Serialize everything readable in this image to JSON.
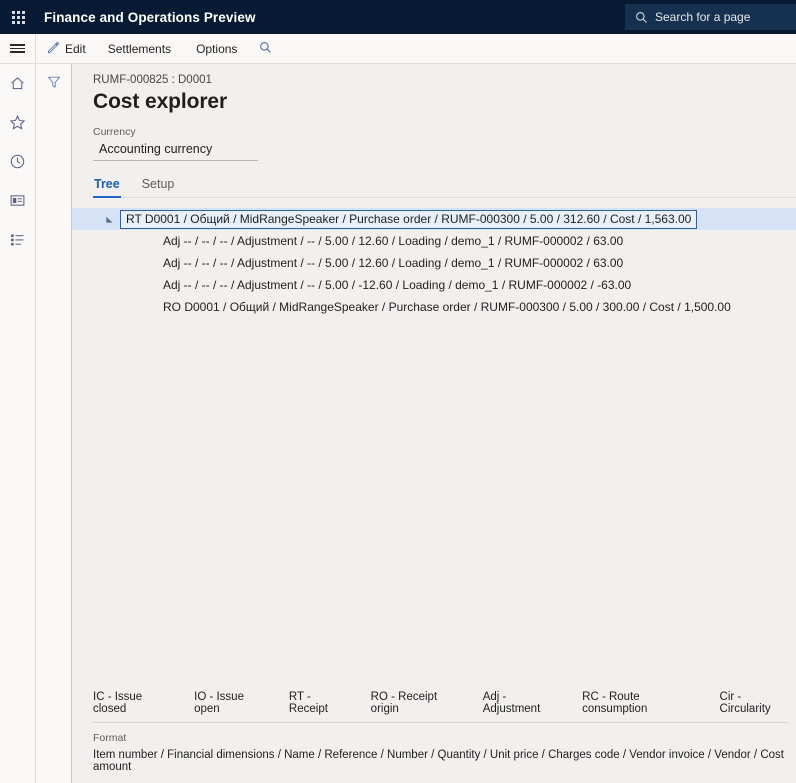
{
  "topbar": {
    "waffle_icon": "app-launcher-grid-icon",
    "app_title": "Finance and Operations Preview",
    "search": {
      "icon": "search-icon",
      "placeholder": "Search for a page",
      "value": "Search for a page"
    }
  },
  "commandbar": {
    "hamburger_icon": "hamburger-menu-icon",
    "buttons": [
      {
        "label": "Edit",
        "icon": "pencil-edit-icon"
      },
      {
        "label": "Settlements",
        "icon": ""
      },
      {
        "label": "Options",
        "icon": ""
      }
    ],
    "search_icon": "search-icon"
  },
  "navrail": {
    "items": [
      {
        "name": "home",
        "icon": "home-icon"
      },
      {
        "name": "favorites",
        "icon": "star-icon"
      },
      {
        "name": "recent",
        "icon": "clock-icon"
      },
      {
        "name": "workspaces",
        "icon": "workspace-icon"
      },
      {
        "name": "modules",
        "icon": "modules-list-icon"
      }
    ]
  },
  "filterpane": {
    "icon": "filter-funnel-icon"
  },
  "page": {
    "breadcrumb": "RUMF-000825 : D0001",
    "title": "Cost explorer",
    "currency": {
      "label": "Currency",
      "value": "Accounting currency"
    },
    "tabs": [
      {
        "label": "Tree",
        "active": true
      },
      {
        "label": "Setup",
        "active": false
      }
    ]
  },
  "tree": {
    "rows": [
      {
        "text": "RT D0001 / Общий / MidRangeSpeaker / Purchase order / RUMF-000300 / 5.00 / 312.60 / Cost / 1,563.00",
        "level": 0,
        "selected": true,
        "expanded": true,
        "toggle_icon": "expanded-triangle-icon"
      },
      {
        "text": "Adj -- / -- / -- / Adjustment / -- / 5.00 / 12.60 / Loading / demo_1 / RUMF-000002 / 63.00",
        "level": 1,
        "selected": false
      },
      {
        "text": "Adj -- / -- / -- / Adjustment / -- / 5.00 / 12.60 / Loading / demo_1 / RUMF-000002 / 63.00",
        "level": 1,
        "selected": false
      },
      {
        "text": "Adj -- / -- / -- / Adjustment / -- / 5.00 / -12.60 / Loading / demo_1 / RUMF-000002 / -63.00",
        "level": 1,
        "selected": false
      },
      {
        "text": "RO D0001 / Общий / MidRangeSpeaker / Purchase order / RUMF-000300 / 5.00 / 300.00 / Cost / 1,500.00",
        "level": 1,
        "selected": false
      }
    ]
  },
  "footer": {
    "legend": [
      "IC - Issue closed",
      "IO - Issue open",
      "RT - Receipt",
      "RO - Receipt origin",
      "Adj - Adjustment",
      "RC - Route consumption",
      "Cir - Circularity"
    ],
    "format_label": "Format",
    "format_value": "Item number / Financial dimensions / Name / Reference / Number / Quantity / Unit price / Charges code / Vendor invoice / Vendor / Cost amount"
  },
  "colors": {
    "topbar_bg": "#061a34",
    "search_bg": "#16314f",
    "accent": "#2266c8",
    "selection_bg": "#d6e2f5",
    "selection_border": "#2f6099",
    "content_bg": "#f2f0ee",
    "panel_bg": "#faf9f8"
  }
}
